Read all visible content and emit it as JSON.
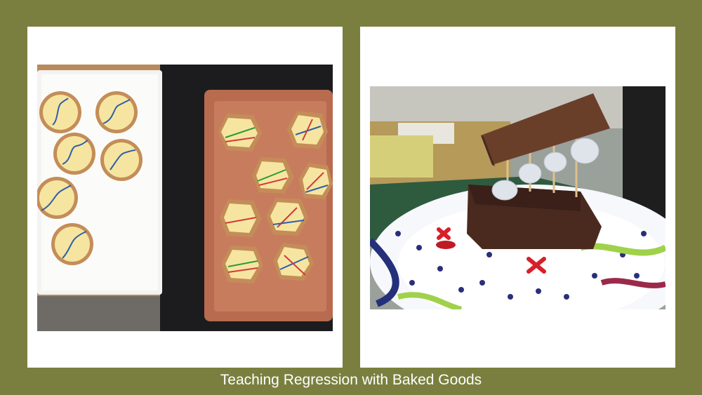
{
  "caption": "Teaching Regression with Baked Goods",
  "photos": [
    {
      "subject": "regression-line-cookies"
    },
    {
      "subject": "brownie-bridge-plate"
    }
  ],
  "colors": {
    "background": "#7a7f3f",
    "frame": "#ffffff",
    "caption_text": "#ffffff"
  }
}
